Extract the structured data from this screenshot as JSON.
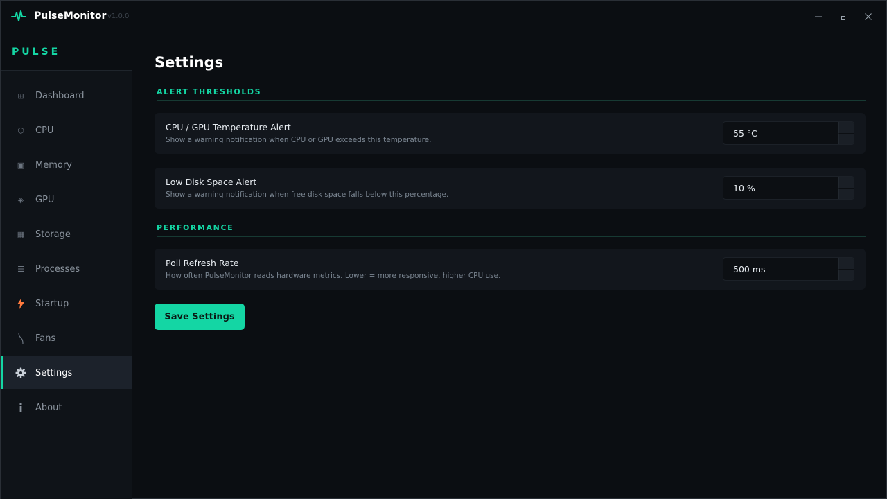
{
  "app": {
    "title": "PulseMonitor",
    "version": "v1.0.0",
    "brand": "PULSE"
  },
  "window_controls": {
    "minimize": "—",
    "maximize": "▫",
    "close": "✕"
  },
  "sidebar": {
    "items": [
      {
        "label": "Dashboard",
        "icon": "grid-icon",
        "glyph": "⊞"
      },
      {
        "label": "CPU",
        "icon": "hexagon-icon",
        "glyph": "⬡"
      },
      {
        "label": "Memory",
        "icon": "memory-chip-icon",
        "glyph": "▣"
      },
      {
        "label": "GPU",
        "icon": "diamond-icon",
        "glyph": "◈"
      },
      {
        "label": "Storage",
        "icon": "storage-icon",
        "glyph": "▦"
      },
      {
        "label": "Processes",
        "icon": "list-icon",
        "glyph": "☰"
      },
      {
        "label": "Startup",
        "icon": "lightning-icon",
        "glyph": "⚡"
      },
      {
        "label": "Fans",
        "icon": "wave-icon",
        "glyph": "∿"
      },
      {
        "label": "Settings",
        "icon": "gear-icon",
        "glyph": "⚙"
      },
      {
        "label": "About",
        "icon": "info-icon",
        "glyph": "ℹ"
      }
    ],
    "active_index": 8
  },
  "main": {
    "title": "Settings",
    "sections": [
      {
        "heading": "ALERT THRESHOLDS",
        "settings": [
          {
            "title": "CPU / GPU Temperature Alert",
            "description": "Show a warning notification when CPU or GPU exceeds this temperature.",
            "value": "55 °C"
          },
          {
            "title": "Low Disk Space Alert",
            "description": "Show a warning notification when free disk space falls below this percentage.",
            "value": "10 %"
          }
        ]
      },
      {
        "heading": "PERFORMANCE",
        "settings": [
          {
            "title": "Poll Refresh Rate",
            "description": "How often PulseMonitor reads hardware metrics. Lower = more responsive, higher CPU use.",
            "value": "500 ms"
          }
        ]
      }
    ],
    "save_label": "Save Settings"
  },
  "colors": {
    "accent": "#14d6a4",
    "background": "#0b0e12",
    "sidebar": "#0f1318",
    "card": "#12161c",
    "startup_icon": "#ff7a3d"
  }
}
